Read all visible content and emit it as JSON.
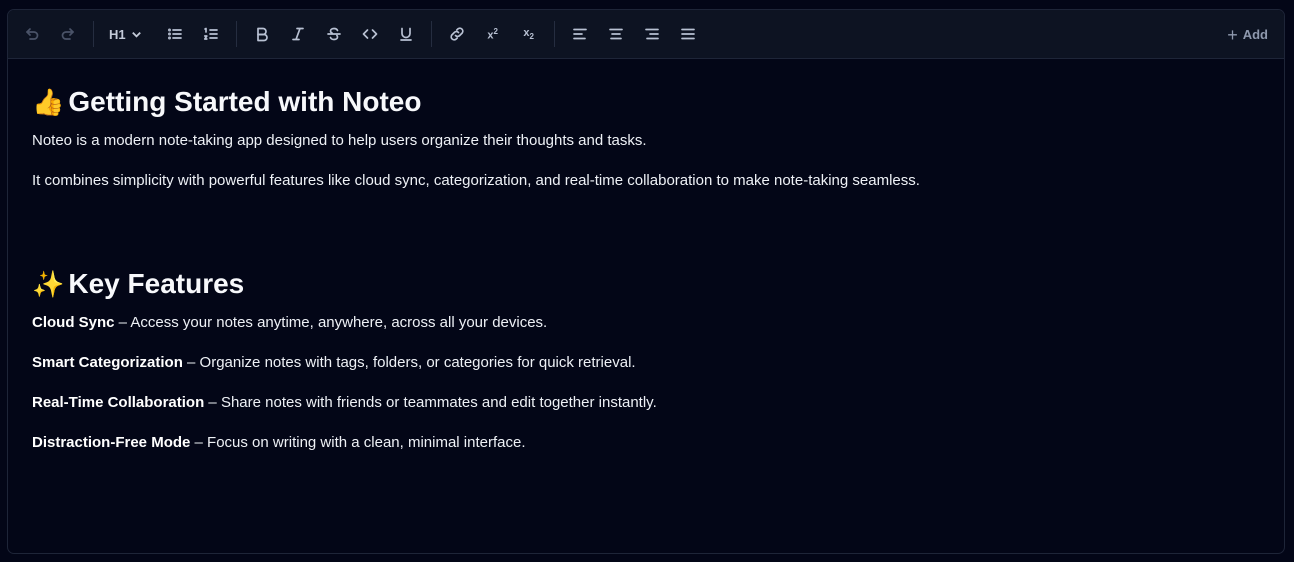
{
  "toolbar": {
    "heading_level": "H1",
    "add_label": "Add",
    "superscript_label": "x",
    "superscript_mark": "2",
    "subscript_label": "x",
    "subscript_mark": "2"
  },
  "document": {
    "section1": {
      "emoji": "👍",
      "title": "Getting Started with Noteo",
      "paragraphs": [
        "Noteo is a modern note-taking app designed to help users organize their thoughts and tasks.",
        "It combines simplicity with powerful features like cloud sync, categorization, and real-time collaboration to make note-taking seamless."
      ]
    },
    "section2": {
      "emoji": "✨",
      "title": "Key Features",
      "features": [
        {
          "name": "Cloud Sync",
          "description": " – Access your notes anytime, anywhere, across all your devices."
        },
        {
          "name": "Smart Categorization",
          "description": " – Organize notes with tags, folders, or categories for quick retrieval."
        },
        {
          "name": "Real-Time Collaboration",
          "description": " – Share notes with friends or teammates and edit together instantly."
        },
        {
          "name": "Distraction-Free Mode",
          "description": " – Focus on writing with a clean, minimal interface."
        }
      ]
    }
  },
  "colors": {
    "background": "#030617",
    "toolbar": "#0d1322",
    "text": "#eef1f6"
  }
}
